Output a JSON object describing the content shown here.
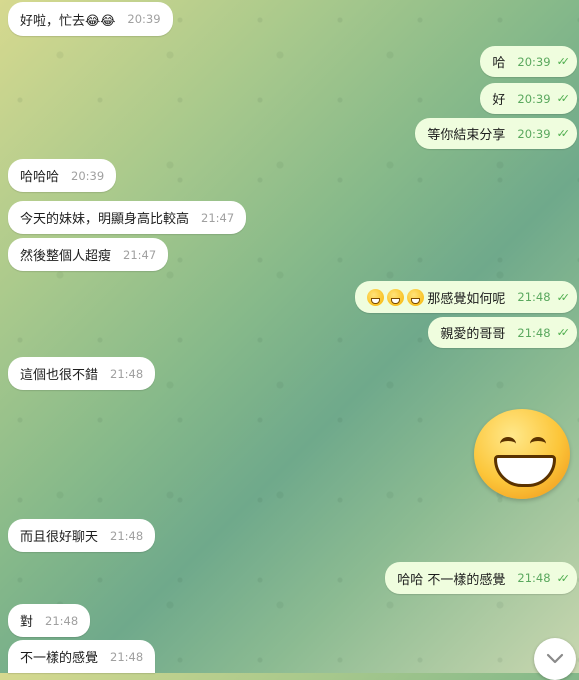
{
  "messages": [
    {
      "text": "好啦，忙去😂😂",
      "time": "20:39"
    },
    {
      "text": "哈",
      "time": "20:39"
    },
    {
      "text": "好",
      "time": "20:39"
    },
    {
      "text": "等你結束分享",
      "time": "20:39"
    },
    {
      "text": "哈哈哈",
      "time": "20:39"
    },
    {
      "text": "今天的妹妹，明顯身高比較高",
      "time": "21:47"
    },
    {
      "text": "然後整個人超瘦",
      "time": "21:47"
    },
    {
      "text": "那感覺如何呢",
      "time": "21:48"
    },
    {
      "text": "親愛的哥哥",
      "time": "21:48"
    },
    {
      "text": "這個也很不錯",
      "time": "21:48"
    },
    {
      "text": "而且很好聊天",
      "time": "21:48"
    },
    {
      "text": "哈哈 不一樣的感覺",
      "time": "21:48"
    },
    {
      "text": "對",
      "time": "21:48"
    },
    {
      "text": "不一樣的感覺",
      "time": "21:48"
    }
  ],
  "icons": {
    "read": "double-check-icon",
    "scroll": "chevron-down-icon",
    "sticker": "grinning-face-sticker"
  },
  "colors": {
    "incoming": "#ffffff",
    "outgoing": "#effdde",
    "check": "#4fae4e"
  }
}
